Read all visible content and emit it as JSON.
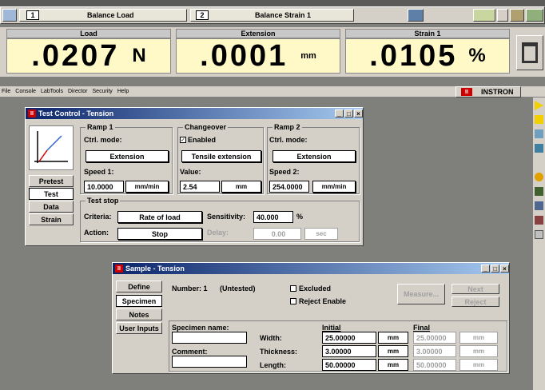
{
  "header": {
    "tab1_num": "1",
    "tab1_label": "Balance Load",
    "tab2_num": "2",
    "tab2_label": "Balance Strain 1"
  },
  "meters": [
    {
      "label": "Load",
      "value": ".0207",
      "unit": "N"
    },
    {
      "label": "Extension",
      "value": ".0001",
      "unit": "mm"
    },
    {
      "label": "Strain 1",
      "value": ".0105",
      "unit": "%"
    }
  ],
  "menu": [
    "File",
    "Console",
    "LabTools",
    "Director",
    "Security",
    "Help"
  ],
  "brand": "INSTRON",
  "test_control": {
    "title": "Test Control - Tension",
    "side": [
      "Pretest",
      "Test",
      "Data",
      "Strain"
    ],
    "ramp1": {
      "cap": "Ramp 1",
      "ctrl": "Ctrl. mode:",
      "mode": "Extension",
      "speed_label": "Speed 1:",
      "speed": "10.0000",
      "unit": "mm/min"
    },
    "changeover": {
      "cap": "Changeover",
      "enabled": "Enabled",
      "mode": "Tensile extension",
      "value_label": "Value:",
      "value": "2.54",
      "unit": "mm"
    },
    "ramp2": {
      "cap": "Ramp 2",
      "ctrl": "Ctrl. mode:",
      "mode": "Extension",
      "speed_label": "Speed 2:",
      "speed": "254.0000",
      "unit": "mm/min"
    },
    "stop": {
      "cap": "Test stop",
      "criteria_label": "Criteria:",
      "criteria": "Rate of load",
      "sens_label": "Sensitivity:",
      "sens": "40.000",
      "sens_unit": "%",
      "action_label": "Action:",
      "action": "Stop",
      "delay_label": "Delay:",
      "delay": "0.00",
      "delay_unit": "sec"
    }
  },
  "sample": {
    "title": "Sample - Tension",
    "side": [
      "Define",
      "Specimen",
      "Notes",
      "User Inputs"
    ],
    "number": "Number: 1",
    "status": "(Untested)",
    "excluded": "Excluded",
    "reject_enable": "Reject Enable",
    "measure": "Measure...",
    "next": "Next",
    "reject": "Reject",
    "name_label": "Specimen name:",
    "comment_label": "Comment:",
    "initial": "Initial",
    "final": "Final",
    "rows": [
      {
        "label": "Width:",
        "initial": "25.00000",
        "unit": "mm",
        "final": "25.00000",
        "funit": "mm"
      },
      {
        "label": "Thickness:",
        "initial": "3.00000",
        "unit": "mm",
        "final": "3.00000",
        "funit": "mm"
      },
      {
        "label": "Length:",
        "initial": "50.00000",
        "unit": "mm",
        "final": "50.00000",
        "funit": "mm"
      }
    ]
  }
}
